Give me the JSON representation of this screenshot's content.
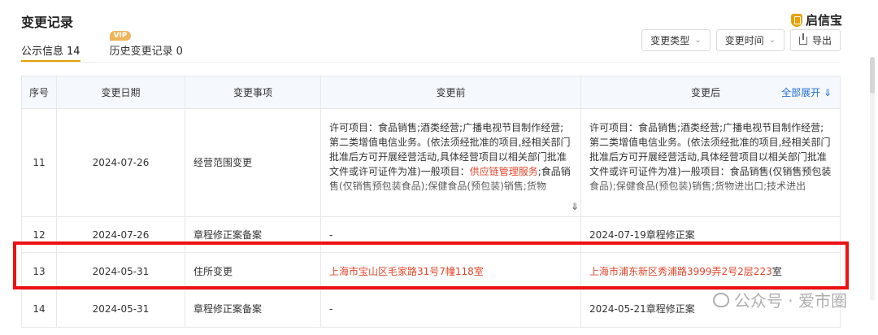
{
  "header": {
    "title": "变更记录",
    "brand": "启信宝"
  },
  "tabs": [
    {
      "label": "公示信息",
      "count": "14"
    },
    {
      "badge": "VIP",
      "label": "历史变更记录",
      "count": "0"
    }
  ],
  "toolbar": {
    "type_label": "变更类型",
    "time_label": "变更时间",
    "export_label": "导出"
  },
  "table": {
    "headers": [
      "序号",
      "变更日期",
      "变更事项",
      "变更前",
      "变更后"
    ],
    "expand_all": "全部展开",
    "rows": [
      {
        "no": "11",
        "date": "2024-07-26",
        "item": "经营范围变更",
        "before_pre": "许可项目：食品销售;酒类经营;广播电视节目制作经营;第二类增值电信业务。(依法须经批准的项目,经相关部门批准后方可开展经营活动,具体经营项目以相关部门批准文件或许可证件为准)一般项目：",
        "before_highlight": "供应链管理服务",
        "before_post": ";食品销售(仅销售预包装食品);保健食品(预包装)销售;货物",
        "after": "许可项目：食品销售;酒类经营;广播电视节目制作经营;第二类增值电信业务。(依法须经批准的项目,经相关部门批准后方可开展经营活动,具体经营项目以相关部门批准文件或许可证件为准)一般项目：食品销售(仅销售预包装食品);保健食品(预包装)销售;货物进出口;技术进出"
      },
      {
        "no": "12",
        "date": "2024-07-26",
        "item": "章程修正案备案",
        "before": "-",
        "after": "2024-07-19章程修正案"
      },
      {
        "no": "13",
        "date": "2024-05-31",
        "item": "住所变更",
        "before": "上海市宝山区毛家路31号7幢118室",
        "after_red": "上海市浦东新区秀浦路3999弄2号2层223",
        "after_tail": "室"
      },
      {
        "no": "14",
        "date": "2024-05-31",
        "item": "章程修正案备案",
        "before": "-",
        "after": "2024-05-21章程修正案"
      }
    ]
  },
  "watermark": {
    "text": "公众号 · 爱市圈"
  },
  "colors": {
    "accent": "#e8a200",
    "link": "#1f6fd1",
    "highlight_text": "#e2462a",
    "annotation_box": "#ee1111"
  }
}
